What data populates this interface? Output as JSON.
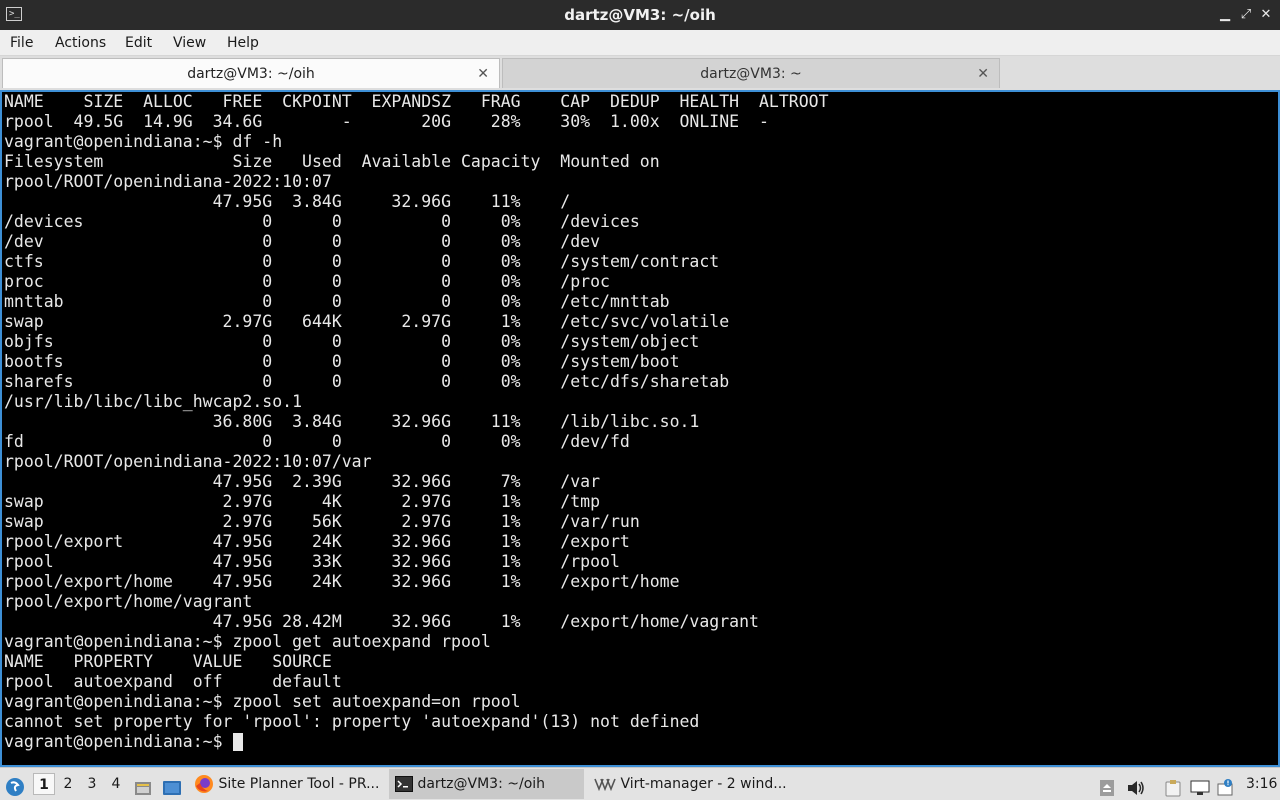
{
  "window": {
    "title": "dartz@VM3: ~/oih",
    "app_icon": "terminal-icon",
    "controls": [
      "minimize-icon",
      "maximize-icon",
      "close-icon"
    ]
  },
  "menu": [
    "File",
    "Actions",
    "Edit",
    "View",
    "Help"
  ],
  "tabs": [
    {
      "label": "dartz@VM3: ~/oih",
      "active": true
    },
    {
      "label": "dartz@VM3: ~",
      "active": false
    }
  ],
  "terminal": {
    "lines": [
      "NAME    SIZE  ALLOC   FREE  CKPOINT  EXPANDSZ   FRAG    CAP  DEDUP  HEALTH  ALTROOT",
      "rpool  49.5G  14.9G  34.6G        -       20G    28%    30%  1.00x  ONLINE  -",
      "vagrant@openindiana:~$ df -h",
      "Filesystem             Size   Used  Available Capacity  Mounted on",
      "rpool/ROOT/openindiana-2022:10:07",
      "                     47.95G  3.84G     32.96G    11%    /",
      "/devices                  0      0          0     0%    /devices",
      "/dev                      0      0          0     0%    /dev",
      "ctfs                      0      0          0     0%    /system/contract",
      "proc                      0      0          0     0%    /proc",
      "mnttab                    0      0          0     0%    /etc/mnttab",
      "swap                  2.97G   644K      2.97G     1%    /etc/svc/volatile",
      "objfs                     0      0          0     0%    /system/object",
      "bootfs                    0      0          0     0%    /system/boot",
      "sharefs                   0      0          0     0%    /etc/dfs/sharetab",
      "/usr/lib/libc/libc_hwcap2.so.1",
      "                     36.80G  3.84G     32.96G    11%    /lib/libc.so.1",
      "fd                        0      0          0     0%    /dev/fd",
      "rpool/ROOT/openindiana-2022:10:07/var",
      "                     47.95G  2.39G     32.96G     7%    /var",
      "swap                  2.97G     4K      2.97G     1%    /tmp",
      "swap                  2.97G    56K      2.97G     1%    /var/run",
      "rpool/export         47.95G    24K     32.96G     1%    /export",
      "rpool                47.95G    33K     32.96G     1%    /rpool",
      "rpool/export/home    47.95G    24K     32.96G     1%    /export/home",
      "rpool/export/home/vagrant",
      "                     47.95G 28.42M     32.96G     1%    /export/home/vagrant",
      "vagrant@openindiana:~$ zpool get autoexpand rpool",
      "NAME   PROPERTY    VALUE   SOURCE",
      "rpool  autoexpand  off     default",
      "vagrant@openindiana:~$ zpool set autoexpand=on rpool",
      "cannot set property for 'rpool': property 'autoexpand'(13) not defined",
      "vagrant@openindiana:~$ "
    ]
  },
  "taskbar": {
    "start_icon": "start-menu-icon",
    "desktops": [
      "1",
      "2",
      "3",
      "4"
    ],
    "active_desktop": "1",
    "launchers": [
      "file-manager-icon",
      "show-desktop-icon"
    ],
    "tasks": [
      {
        "label": "Site Planner Tool - PR...",
        "icon": "firefox-icon",
        "active": false
      },
      {
        "label": "dartz@VM3: ~/oih",
        "icon": "terminal-icon",
        "active": true
      },
      {
        "label": "Virt-manager - 2 wind...",
        "icon": "virt-manager-icon",
        "active": false
      }
    ],
    "tray_icons": [
      "removable-media-icon",
      "volume-icon",
      "clipboard-icon",
      "display-icon",
      "update-notifier-icon"
    ],
    "clock": "3:16"
  },
  "colors": {
    "terminal_bg": "#000000",
    "terminal_fg": "#e8e8e8",
    "focus_border": "#3d8fd6",
    "titlebar_bg": "#2b2b2b"
  }
}
